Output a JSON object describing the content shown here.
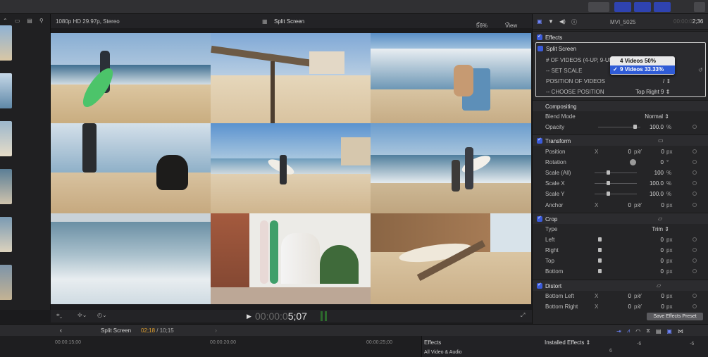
{
  "viewer": {
    "format": "1080p HD 29.97p, Stereo",
    "title": "Split Screen",
    "zoom": "56%",
    "view_label": "View",
    "timecode_dim": "00:00:0",
    "timecode_bright": "5;07"
  },
  "inspector": {
    "clip_name": "MVI_5025",
    "duration_dim": "00:00:0",
    "duration_bright": "2;36",
    "effects_section": "Effects",
    "split_screen": {
      "title": "Split Screen",
      "row1": "# OF VIDEOS (4-UP, 9-UP)",
      "row2": "-- SET SCALE",
      "row3": "POSITION OF VIDEOS",
      "row3_value": "/",
      "row4": "-- CHOOSE POSITION",
      "row4_value": "Top Right 9"
    },
    "dropdown": {
      "options": [
        "4 Videos 50%",
        "9 Videos 33.33%"
      ],
      "selected": 1
    },
    "compositing": {
      "title": "Compositing",
      "blend_label": "Blend Mode",
      "blend_value": "Normal",
      "opacity_label": "Opacity",
      "opacity_value": "100.0",
      "opacity_unit": "%"
    },
    "transform": {
      "title": "Transform",
      "position_label": "Position",
      "position_x": "0",
      "position_y": "0",
      "rotation_label": "Rotation",
      "rotation_value": "0",
      "rotation_unit": "°",
      "scale_all_label": "Scale (All)",
      "scale_all_value": "100",
      "scale_x_label": "Scale X",
      "scale_x_value": "100.0",
      "scale_y_label": "Scale Y",
      "scale_y_value": "100.0",
      "anchor_label": "Anchor",
      "anchor_x": "0",
      "anchor_y": "0"
    },
    "crop": {
      "title": "Crop",
      "type_label": "Type",
      "type_value": "Trim",
      "left_label": "Left",
      "left_value": "0",
      "right_label": "Right",
      "right_value": "0",
      "top_label": "Top",
      "top_value": "0",
      "bottom_label": "Bottom",
      "bottom_value": "0"
    },
    "distort": {
      "title": "Distort",
      "bl_label": "Bottom Left",
      "bl_x": "0",
      "bl_y": "0",
      "br_label": "Bottom Right",
      "br_x": "0",
      "br_y": "0"
    },
    "axis_x": "X",
    "axis_y": "Y",
    "unit_px": "px",
    "unit_pct": "%",
    "save_button": "Save Effects Preset"
  },
  "timeline": {
    "project": "Split Screen",
    "position": "02;18",
    "separator": " / ",
    "duration": "10;15",
    "ticks": [
      "00:00:15;00",
      "00:00:20;00",
      "00:00:25;00"
    ]
  },
  "browser": {
    "effects_label": "Effects",
    "installed_label": "Installed Effects",
    "category": "All Video & Audio",
    "meter": [
      "6",
      "-6",
      "-6"
    ]
  },
  "colors": {
    "accent": "#2f43b0",
    "checkbox": "#3b5bdb",
    "selection": "#2f5bd6",
    "timecode_orange": "#e0a030"
  }
}
